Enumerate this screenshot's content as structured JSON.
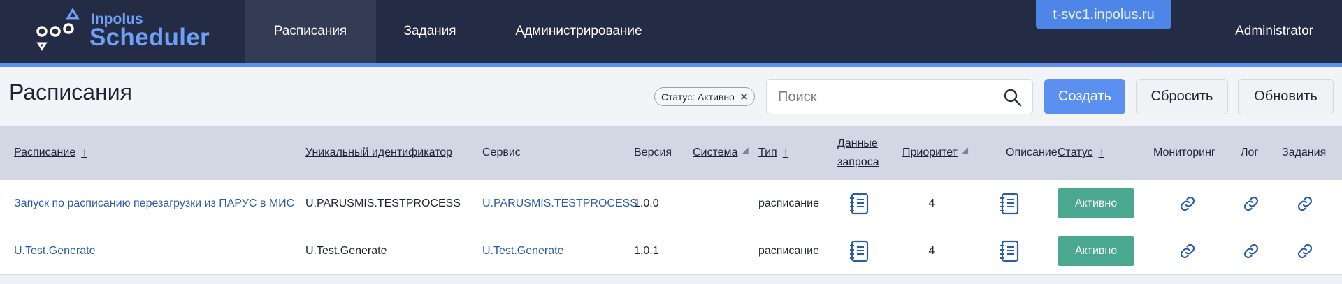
{
  "app": {
    "logo_small": "Inpolus",
    "logo_big": "Scheduler",
    "server": "t-svc1.inpolus.ru",
    "user": "Administrator"
  },
  "nav": {
    "items": [
      {
        "label": "Расписания",
        "active": true
      },
      {
        "label": "Задания",
        "active": false
      },
      {
        "label": "Администрирование",
        "active": false
      }
    ]
  },
  "toolbar": {
    "title": "Расписания",
    "filter_chip": "Статус: Активно",
    "search_placeholder": "Поиск",
    "create_label": "Создать",
    "reset_label": "Сбросить",
    "refresh_label": "Обновить"
  },
  "table": {
    "headers": {
      "schedule": "Расписание",
      "uid": "Уникальный идентификатор",
      "service": "Сервис",
      "version": "Версия",
      "system": "Система",
      "type": "Тип",
      "request_line1": "Данные",
      "request_line2": "запроса",
      "priority": "Приоритет",
      "description": "Описание",
      "status": "Статус",
      "monitoring": "Мониторинг",
      "log": "Лог",
      "jobs": "Задания"
    },
    "rows": [
      {
        "schedule": "Запуск по расписанию перезагрузки из ПАРУС в МИС",
        "uid": "U.PARUSMIS.TESTPROCESS",
        "service": "U.PARUSMIS.TESTPROCESS",
        "version": "1.0.0",
        "system": "",
        "type": "расписание",
        "priority": "4",
        "status": "Активно"
      },
      {
        "schedule": "U.Test.Generate",
        "uid": "U.Test.Generate",
        "service": "U.Test.Generate",
        "version": "1.0.1",
        "system": "",
        "type": "расписание",
        "priority": "4",
        "status": "Активно"
      }
    ]
  },
  "colors": {
    "navbar": "#232b45",
    "accent": "#5b8ff0",
    "status_active": "#4aa88e",
    "link": "#2a5cab",
    "icon": "#2a5cab"
  },
  "icons": {
    "request_data": "notebook-icon",
    "description": "notebook-icon",
    "monitoring": "link-icon",
    "log": "link-icon",
    "jobs": "link-icon",
    "search": "search-icon",
    "sort": "arrow-up-icon"
  }
}
